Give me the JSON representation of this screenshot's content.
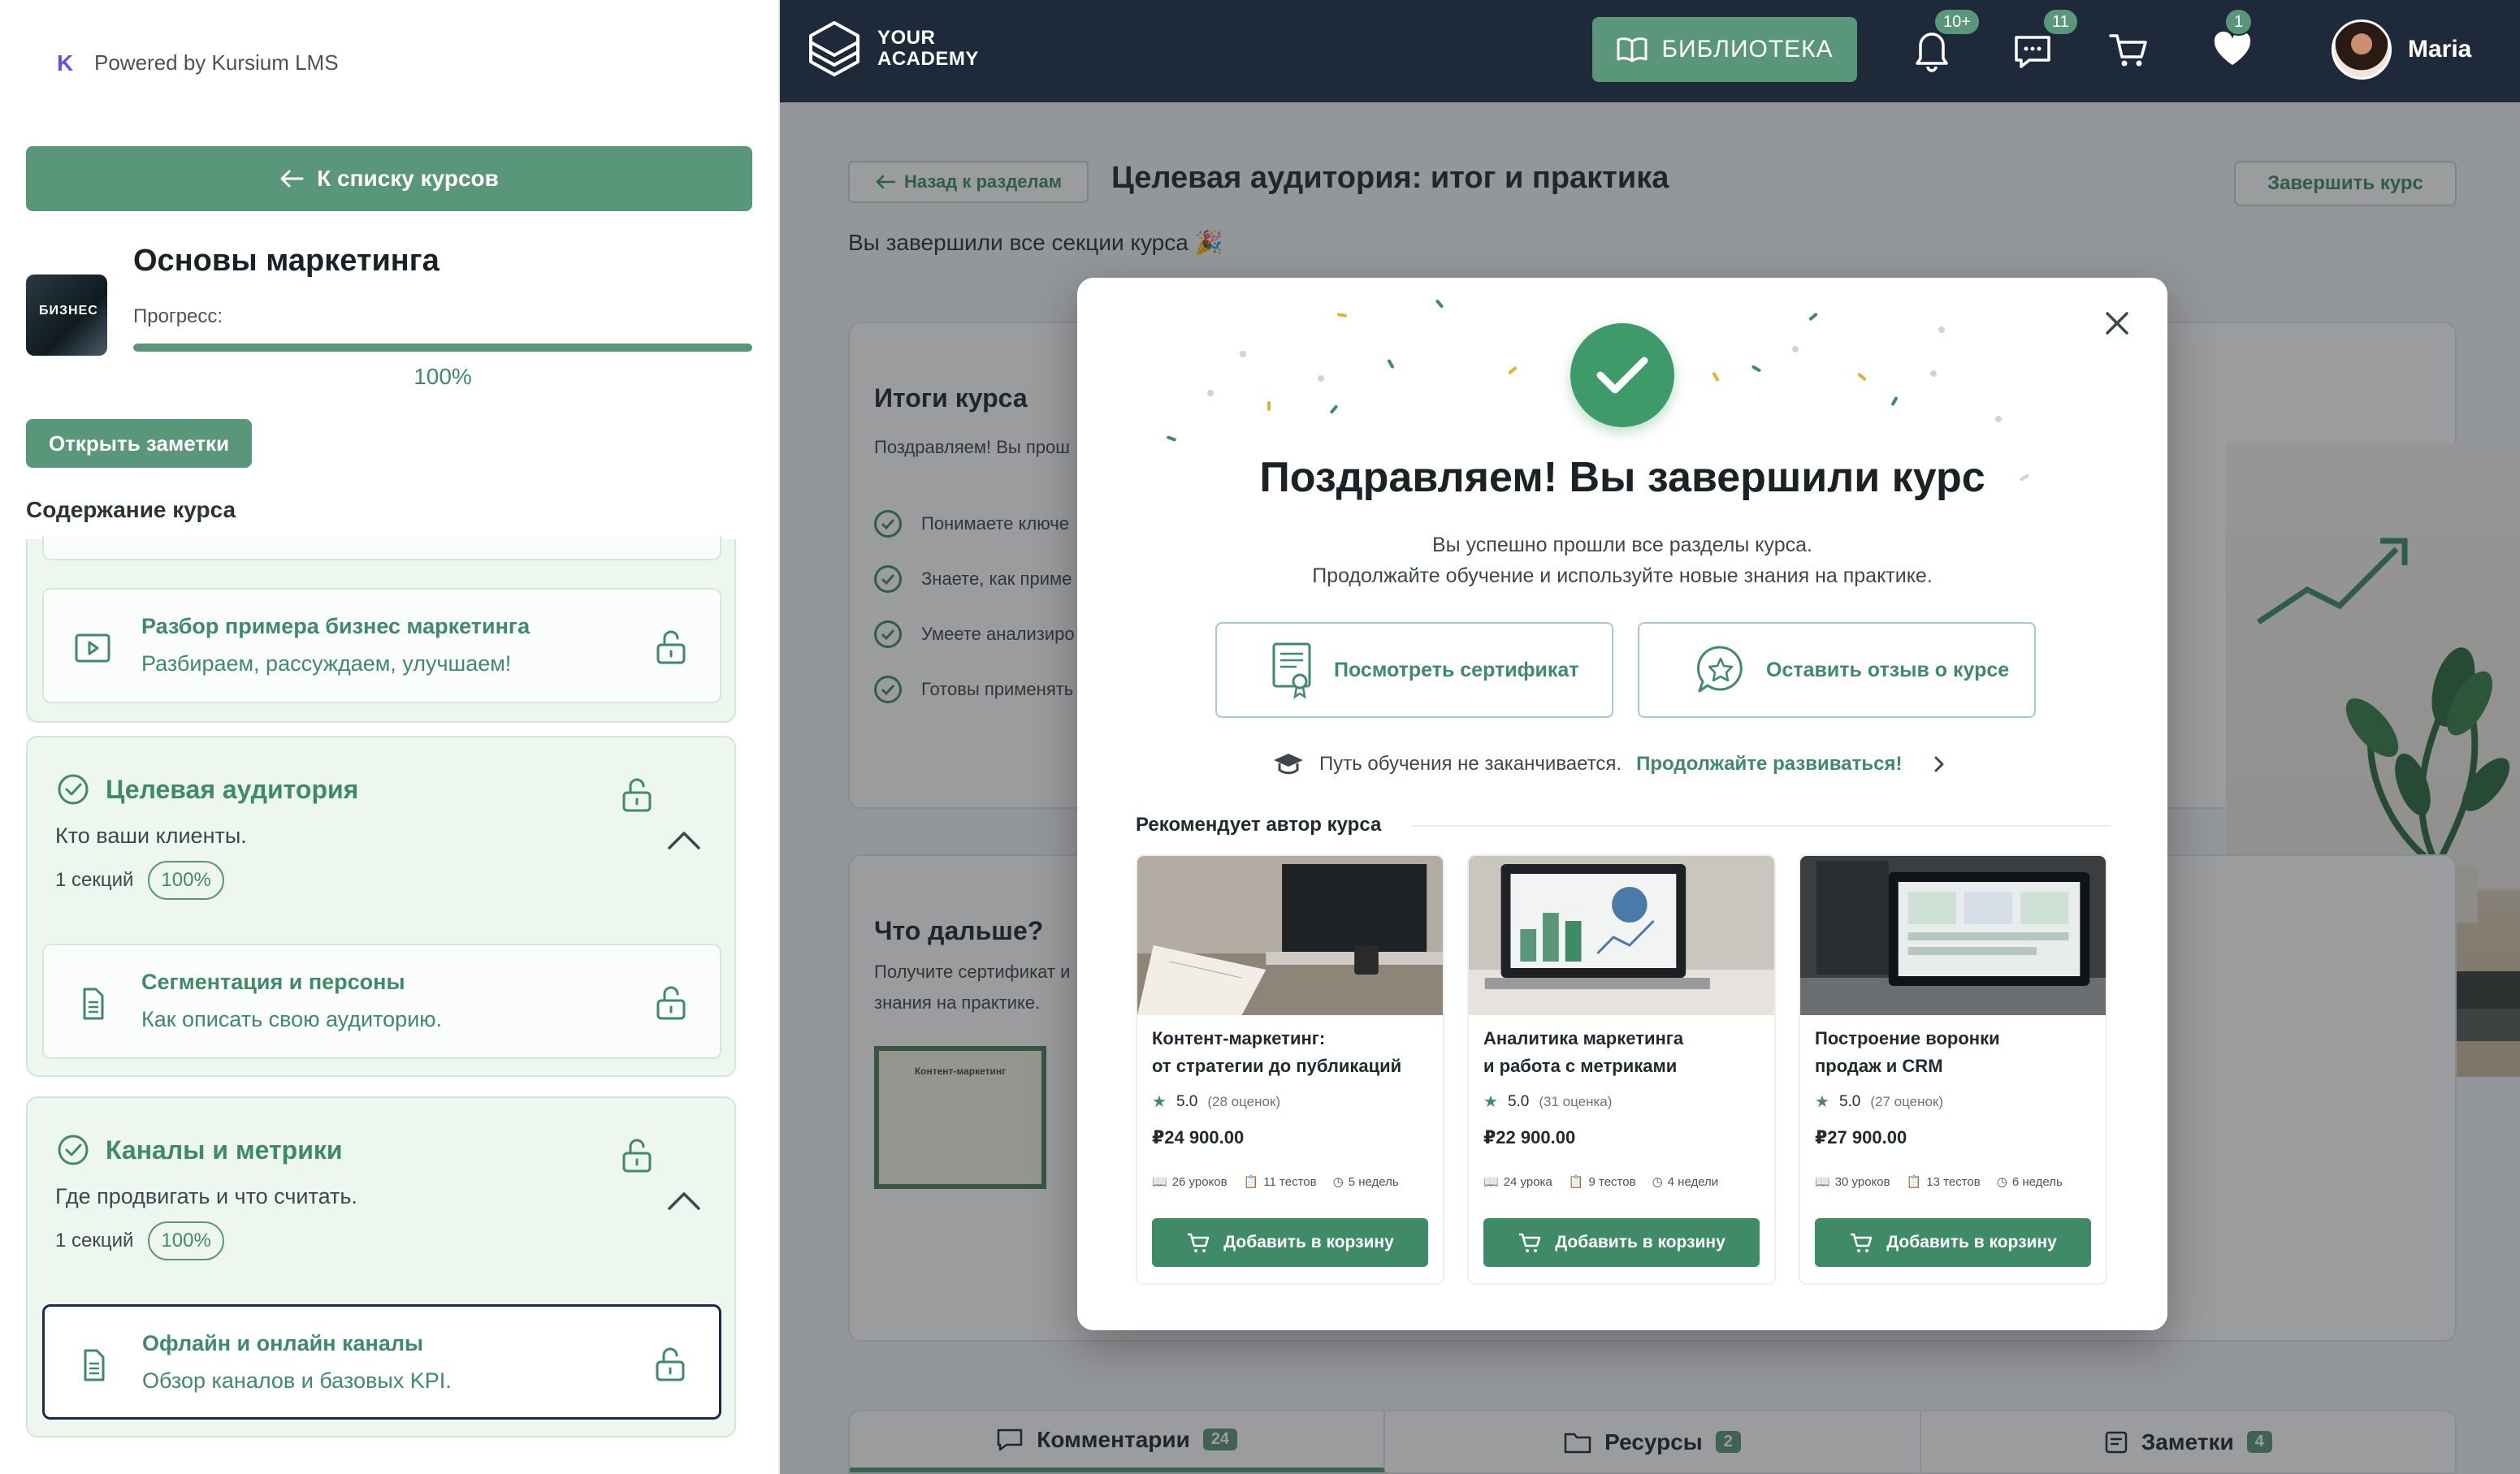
{
  "sidebar": {
    "powered_by": "Powered by Kursium LMS",
    "back_to_courses": "К списку курсов",
    "course_title": "Основы маркетинга",
    "course_thumb_text": "БИЗНЕС",
    "progress_label": "Прогресс:",
    "progress_value": 100,
    "progress_text": "100%",
    "open_notes": "Открыть заметки",
    "contents_heading": "Содержание курса",
    "modules": [
      {
        "lesson_title": "Разбор примера бизнес маркетинга",
        "lesson_sub": "Разбираем, рассуждаем, улучшаем!"
      },
      {
        "title": "Целевая аудитория",
        "desc": "Кто ваши клиенты.",
        "sections": "1 секций",
        "pct": "100%",
        "lesson_title": "Сегментация и персоны",
        "lesson_sub": "Как описать свою аудиторию."
      },
      {
        "title": "Каналы и метрики",
        "desc": "Где продвигать и что считать.",
        "sections": "1 секций",
        "pct": "100%",
        "lesson_title": "Офлайн и онлайн каналы",
        "lesson_sub": "Обзор каналов и базовых KPI."
      }
    ]
  },
  "topbar": {
    "logo_line1": "YOUR",
    "logo_line2": "ACADEMY",
    "library": "БИБЛИОТЕКА",
    "notifications_badge": "10+",
    "messages_badge": "11",
    "favorites_badge": "1",
    "user_name": "Maria"
  },
  "page": {
    "back_to_sections": "Назад к разделам",
    "title": "Целевая аудитория: итог и практика",
    "finish_course": "Завершить курс",
    "done_text": "Вы завершили все секции курса 🎉",
    "summary_title": "Итоги курса",
    "summary_text": "Поздравляем! Вы прош",
    "checks": [
      "Понимаете ключе",
      "Знаете, как приме",
      "Умеете анализиро",
      "Готовы применять"
    ],
    "next_title": "Что дальше?",
    "next_text_1": "Получите сертификат и",
    "next_text_2": "знания на практике.",
    "cert_thumb_title": "Контент-маркетинг",
    "tabs": [
      {
        "label": "Комментарии",
        "count": "24"
      },
      {
        "label": "Ресурсы",
        "count": "2"
      },
      {
        "label": "Заметки",
        "count": "4"
      }
    ]
  },
  "modal": {
    "title": "Поздравляем! Вы завершили курс",
    "sub_line1": "Вы успешно прошли все разделы курса.",
    "sub_line2": "Продолжайте обучение и используйте новые знания на практике.",
    "view_certificate": "Посмотреть сертификат",
    "leave_review": "Оставить отзыв о курсе",
    "path_text": "Путь обучения не заканчивается.",
    "path_link": "Продолжайте развиваться!",
    "reco_title": "Рекомендует автор курса",
    "products": [
      {
        "name_line1": "Контент-маркетинг:",
        "name_line2": "от стратегии до публикаций",
        "rating": "5.0",
        "rating_count": "(28 оценок)",
        "price": "₽24 900.00",
        "lessons": "26 уроков",
        "tests": "11 тестов",
        "duration": "5 недель",
        "cart": "Добавить в корзину"
      },
      {
        "name_line1": "Аналитика маркетинга",
        "name_line2": "и работа с метриками",
        "rating": "5.0",
        "rating_count": "(31 оценка)",
        "price": "₽22 900.00",
        "lessons": "24 урока",
        "tests": "9 тестов",
        "duration": "4 недели",
        "cart": "Добавить в корзину"
      },
      {
        "name_line1": "Построение воронки",
        "name_line2": "продаж и CRM",
        "rating": "5.0",
        "rating_count": "(27 оценок)",
        "price": "₽27 900.00",
        "lessons": "30 уроков",
        "tests": "13 тестов",
        "duration": "6 недель",
        "cart": "Добавить в корзину"
      }
    ]
  },
  "colors": {
    "accent": "#5a967a",
    "accent_dark": "#3f8a67",
    "topbar": "#1e2a3a"
  },
  "icons": [
    "k-logo-icon",
    "arrow-left-icon",
    "play-icon",
    "document-icon",
    "unlock-icon",
    "check-circle-icon",
    "chevron-up-icon",
    "academy-logo-icon",
    "book-icon",
    "bell-icon",
    "chat-icon",
    "cart-icon",
    "heart-icon",
    "close-icon",
    "certificate-icon",
    "star-chat-icon",
    "graduation-cap-icon",
    "chevron-right-icon",
    "star-icon",
    "clock-icon",
    "test-icon"
  ]
}
